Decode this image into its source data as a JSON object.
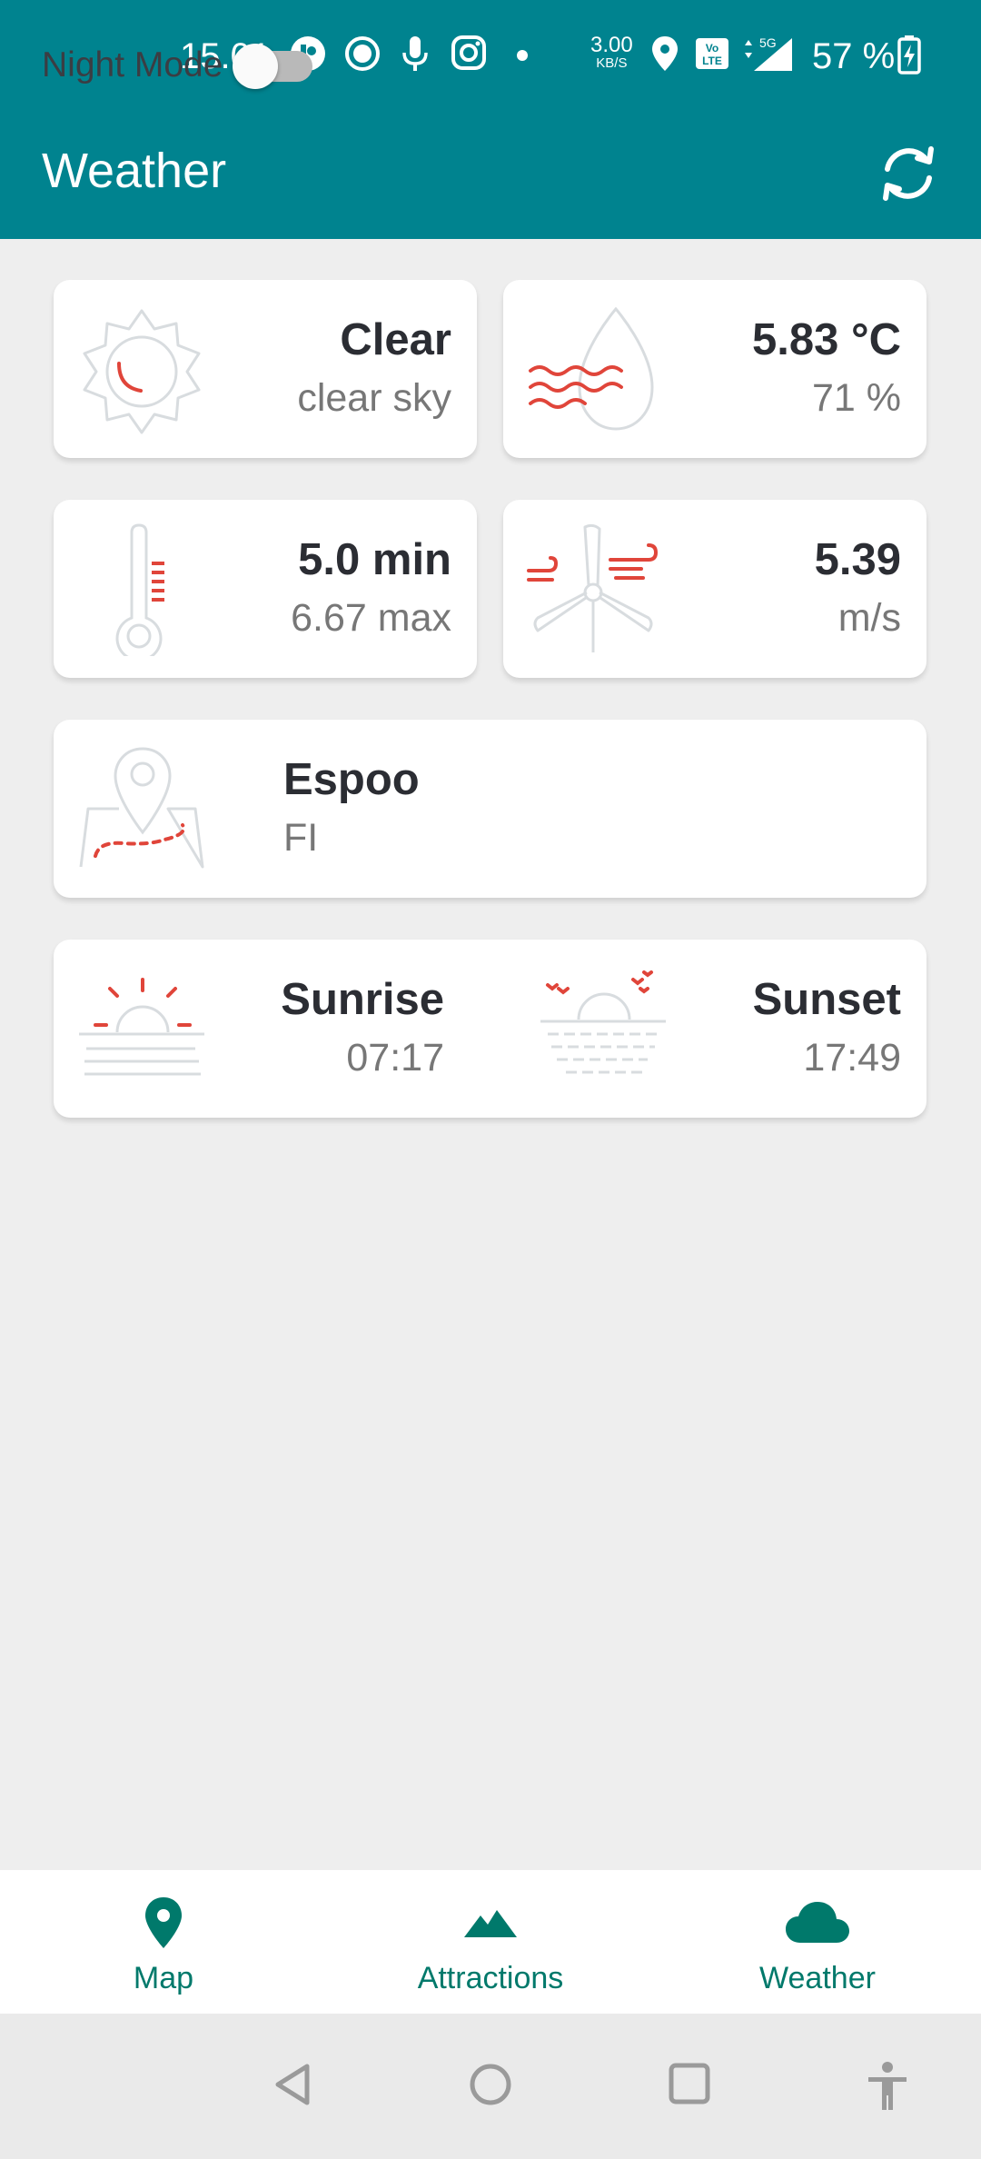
{
  "status_bar": {
    "time": "15.01",
    "net_speed_value": "3.00",
    "net_speed_unit": "KB/S",
    "network": "5G",
    "battery": "57 %"
  },
  "app_bar": {
    "title": "Weather"
  },
  "cards": {
    "condition": {
      "title": "Clear",
      "subtitle": "clear sky"
    },
    "temperature": {
      "title": "5.83 °C",
      "subtitle": "71 %"
    },
    "min_max": {
      "title": "5.0 min",
      "subtitle": "6.67 max"
    },
    "wind": {
      "title": "5.39",
      "subtitle": "m/s"
    },
    "location": {
      "title": "Espoo",
      "subtitle": "FI"
    },
    "sun": {
      "sunrise_label": "Sunrise",
      "sunrise_time": "07:17",
      "sunset_label": "Sunset",
      "sunset_time": "17:49"
    }
  },
  "night_mode": {
    "label": "Night Mode",
    "enabled": false
  },
  "bottom_nav": {
    "items": [
      {
        "label": "Map",
        "icon": "map-pin-icon"
      },
      {
        "label": "Attractions",
        "icon": "mountains-icon"
      },
      {
        "label": "Weather",
        "icon": "cloud-icon"
      }
    ],
    "selected": "Weather"
  },
  "colors": {
    "primary": "#00838f",
    "accent_red": "#e0453a",
    "nav_teal": "#00796b",
    "background": "#eeeeee"
  }
}
